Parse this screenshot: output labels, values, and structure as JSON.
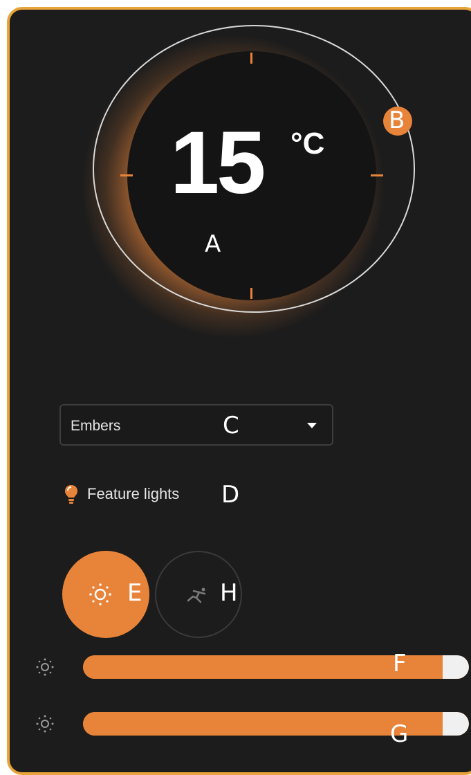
{
  "thermostat": {
    "temperature": "15",
    "unit": "°C"
  },
  "annotations": {
    "a": "A",
    "b": "B",
    "c": "C",
    "d": "D",
    "e": "E",
    "f": "F",
    "g": "G",
    "h": "H"
  },
  "flame_effect": {
    "selected": "Embers"
  },
  "feature_lights": {
    "label": "Feature lights"
  },
  "mode_buttons": [
    {
      "icon": "sun-icon",
      "active": true
    },
    {
      "icon": "running-person-icon",
      "active": false
    }
  ],
  "sliders": [
    {
      "icon": "brightness-icon",
      "level": 0.94
    },
    {
      "icon": "brightness-icon",
      "level": 0.94
    }
  ],
  "colors": {
    "accent": "#e8843a",
    "border": "#e8a33a",
    "panel": "#1c1c1c"
  }
}
